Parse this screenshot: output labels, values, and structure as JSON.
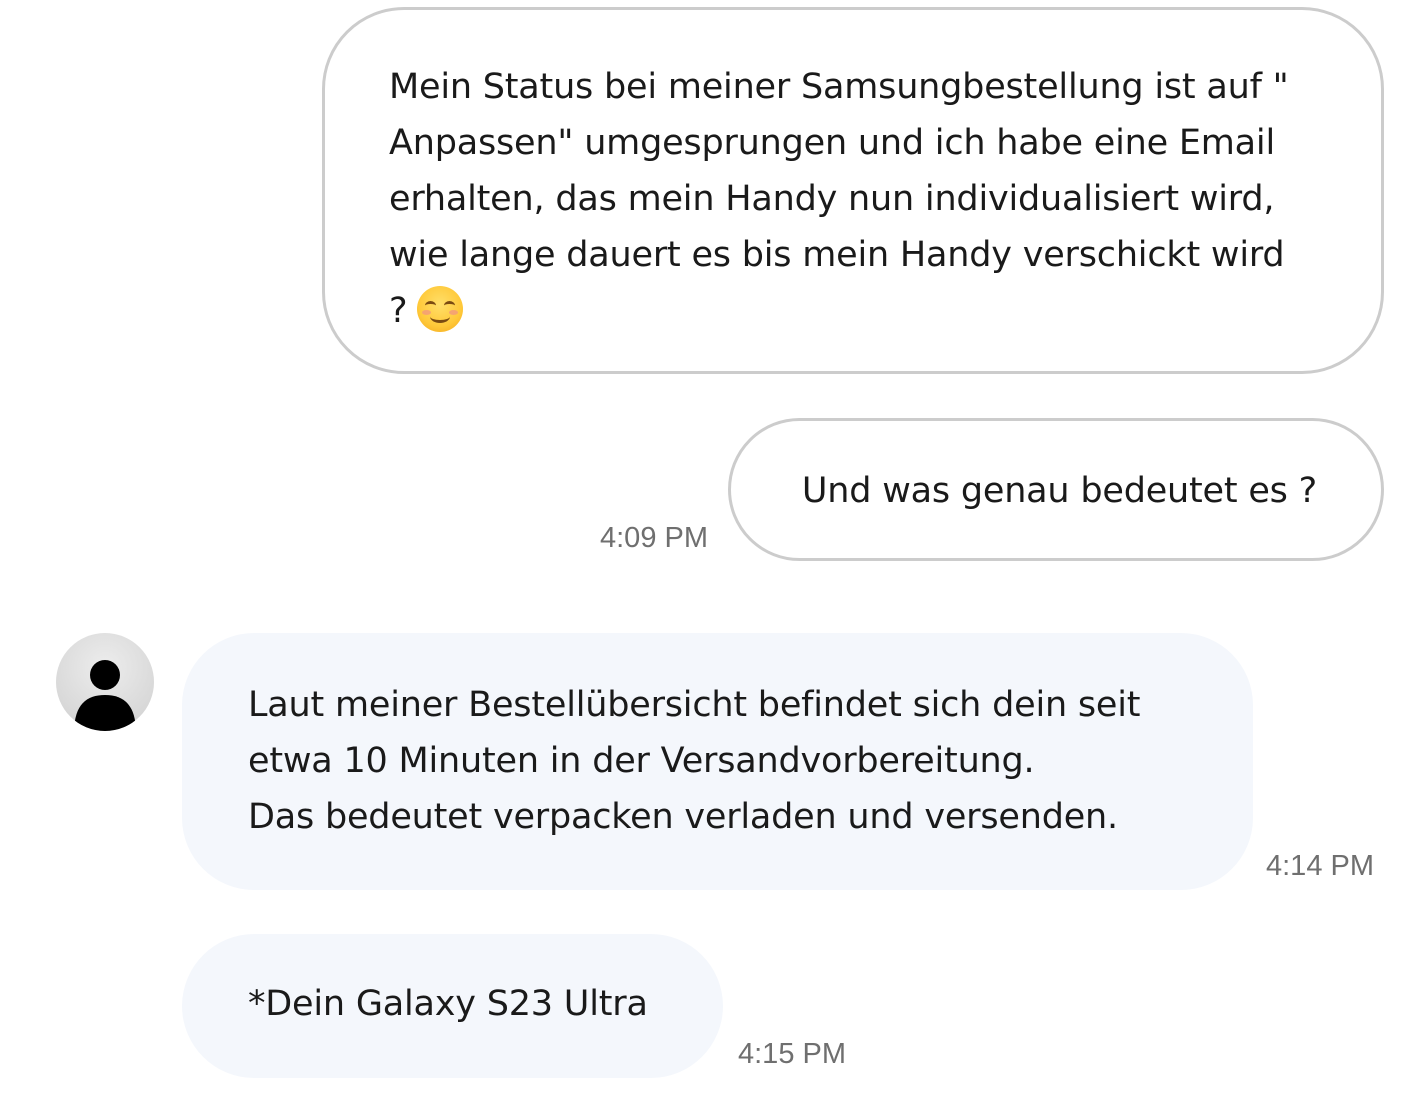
{
  "messages": [
    {
      "direction": "outgoing",
      "text": "Mein Status bei meiner Samsungbestellung ist auf \"\nAnpassen\" umgesprungen und ich habe eine Email\nerhalten, das mein Handy nun individualisiert wird,\nwie lange dauert es bis mein Handy verschickt wird\n?",
      "emoji": "smiling-face-icon"
    },
    {
      "direction": "outgoing",
      "text": "Und was genau bedeutet es ?",
      "time": "4:09 PM"
    },
    {
      "direction": "incoming",
      "text": "Laut meiner Bestellübersicht befindet sich dein seit\netwa 10 Minuten in der Versandvorbereitung.\nDas bedeutet verpacken verladen und versenden.",
      "time": "4:14 PM"
    },
    {
      "direction": "incoming",
      "text": "*Dein Galaxy S23 Ultra",
      "time": "4:15 PM"
    }
  ],
  "avatar": {
    "icon": "default-user-avatar-icon"
  },
  "colors": {
    "outgoing_bubble_bg": "#ffffff",
    "outgoing_bubble_border": "#cccccc",
    "incoming_bubble_bg": "#f4f7fc",
    "timestamp": "#6f6f6f",
    "text": "#1a1a1a"
  }
}
